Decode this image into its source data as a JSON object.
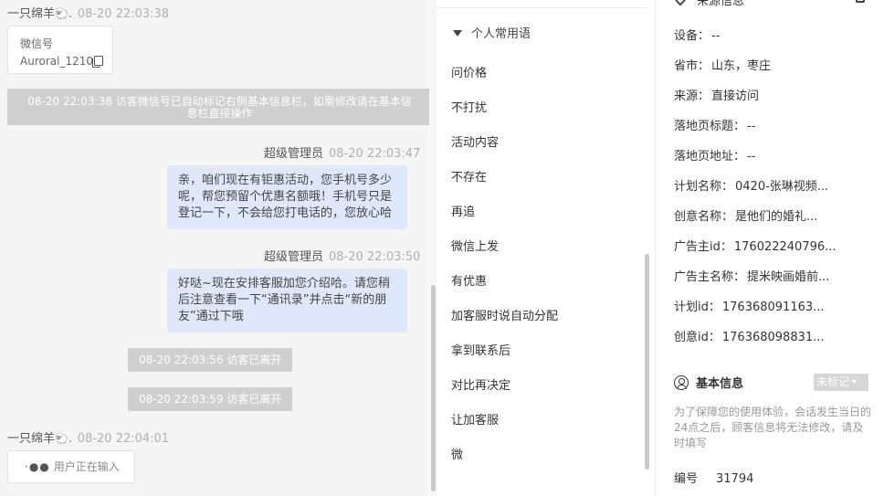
{
  "chat": {
    "messages": [
      {
        "sender": "一只绵羊",
        "emoji": "🐑.",
        "time": "08-20 22:03:38"
      },
      {
        "card_label": "微信号",
        "card_value": "Auroral_1210"
      },
      {
        "system_wide": "08-20 22:03:38 访客微信号已自动标记右侧基本信息栏，如需修改请在基本信息栏直接操作"
      },
      {
        "sender": "超级管理员",
        "time": "08-20 22:03:47",
        "text": "亲，咱们现在有钜惠活动，您手机号多少呢，帮您预留个优惠名额哦！手机号只是登记一下，不会给您打电话的，您放心哈"
      },
      {
        "sender": "超级管理员",
        "time": "08-20 22:03:50",
        "text": "好哒~现在安排客服加您介绍哈。请您稍后注意查看一下“通讯录”并点击“新的朋友”通过下哦"
      },
      {
        "system": "08-20 22:03:56 访客已离开"
      },
      {
        "system": "08-20 22:03:59 访客已离开"
      },
      {
        "sender": "一只绵羊",
        "emoji": "🐑.",
        "time": "08-20 22:04:01"
      }
    ],
    "typing_dots": "·●●",
    "typing_text": "用户正在输入"
  },
  "phrases": {
    "header": "个人常用语",
    "items": [
      "问价格",
      "不打扰",
      "活动内容",
      "不存在",
      "再追",
      "微信上发",
      "有优惠",
      "加客服时说自动分配",
      "拿到联系后",
      "对比再决定",
      "让加客服",
      "微"
    ]
  },
  "info": {
    "source_title": "来源信息",
    "rows": [
      {
        "label": "设备：",
        "value": "--"
      },
      {
        "label": "省市：",
        "value": "山东，枣庄"
      },
      {
        "label": "来源：",
        "value": "直接访问"
      },
      {
        "label": "落地页标题：",
        "value": "--"
      },
      {
        "label": "落地页地址：",
        "value": "--"
      },
      {
        "label": "计划名称：",
        "value": "0420-张琳视频..."
      },
      {
        "label": "创意名称：",
        "value": "是他们的婚礼..."
      },
      {
        "label": "广告主id：",
        "value": "176022240796..."
      },
      {
        "label": "广告主名称：",
        "value": "提米映画婚前..."
      },
      {
        "label": "计划id：",
        "value": "176368091163..."
      },
      {
        "label": "创意id：",
        "value": "176368098831..."
      }
    ],
    "basic_title": "基本信息",
    "tag_label": "未标记",
    "notice": "为了保障您的使用体验，会话发生当日的24点之后，顾客信息将无法修改，请及时填写",
    "id_label": "编号",
    "id_value": "31794"
  }
}
